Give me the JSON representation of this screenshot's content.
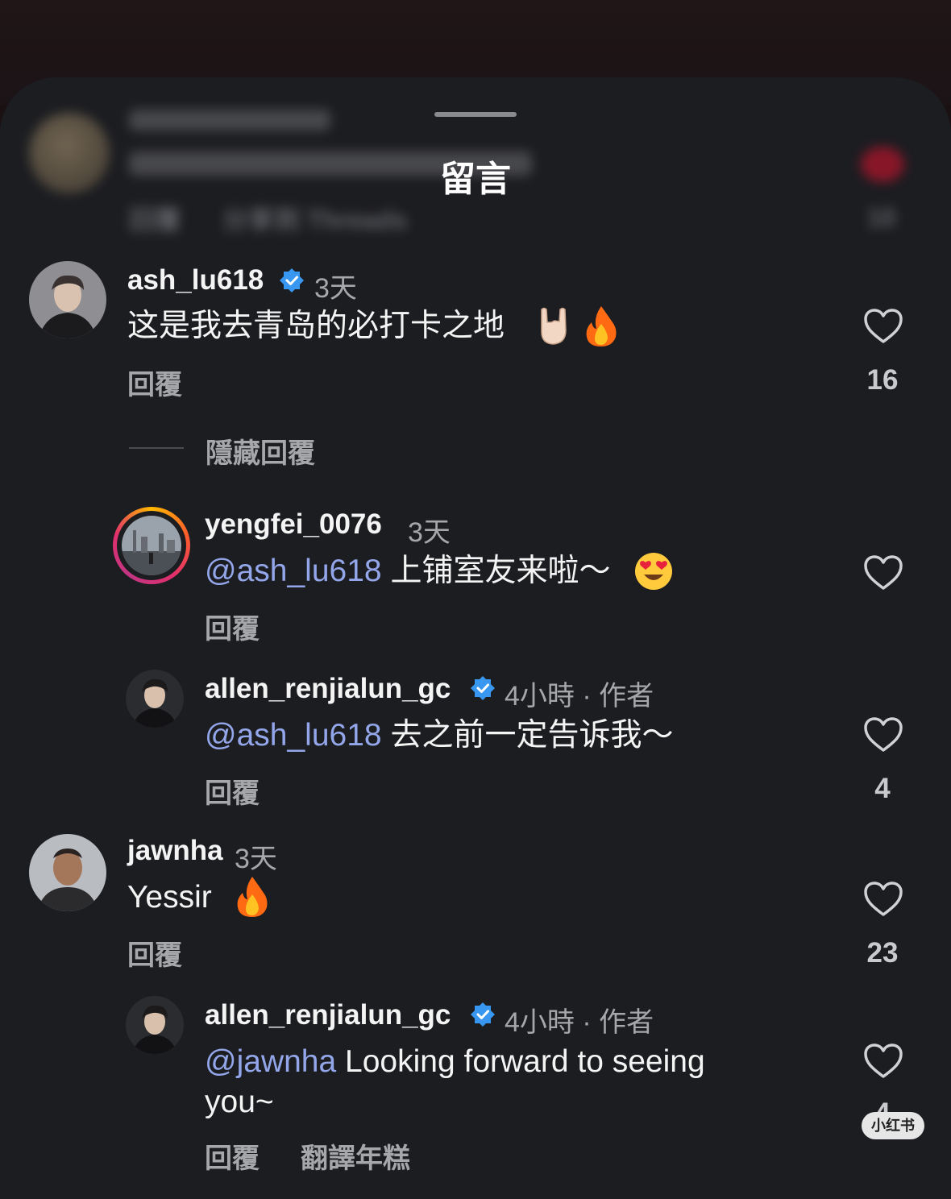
{
  "sheet": {
    "title": "留言"
  },
  "blurred_comment": {
    "actions": [
      "回覆",
      "分享到 Threads"
    ],
    "like_count": "10"
  },
  "comments": [
    {
      "username": "ash_lu618",
      "verified": true,
      "time": "3天",
      "text": "这是我去青岛的必打卡之地",
      "emojis": [
        "sign-of-horns-emoji",
        "fire-emoji"
      ],
      "reply_label": "回覆",
      "like_count": "16",
      "hide_replies_label": "隱藏回覆",
      "replies": [
        {
          "username": "yengfei_0076",
          "verified": false,
          "time": "3天",
          "mention": "@ash_lu618",
          "text": "上铺室友来啦～",
          "emojis": [
            "heart-eyes-emoji"
          ],
          "reply_label": "回覆",
          "like_count": ""
        },
        {
          "username": "allen_renjialun_gc",
          "verified": true,
          "time": "4小時 · 作者",
          "mention": "@ash_lu618",
          "text": "去之前一定告诉我～",
          "reply_label": "回覆",
          "like_count": "4"
        }
      ]
    },
    {
      "username": "jawnha",
      "verified": false,
      "time": "3天",
      "text": "Yessir",
      "emojis": [
        "fire-emoji"
      ],
      "reply_label": "回覆",
      "like_count": "23",
      "replies": [
        {
          "username": "allen_renjialun_gc",
          "verified": true,
          "time": "4小時 · 作者",
          "mention": "@jawnha",
          "text_line1": "Looking forward to seeing",
          "text_line2": "you~",
          "reply_label": "回覆",
          "translate_label": "翻譯年糕",
          "like_count": "4"
        }
      ]
    }
  ],
  "watermark": "小红书",
  "colors": {
    "background": "#1c1d21",
    "mention": "#93a6ea",
    "muted": "#a6a7ab"
  }
}
